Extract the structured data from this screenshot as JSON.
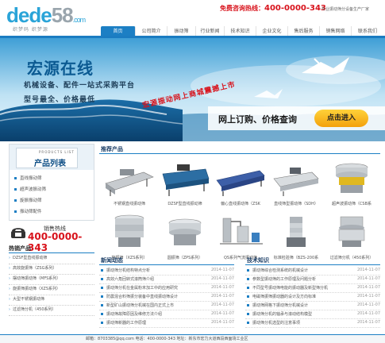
{
  "header": {
    "logo_main_a": "dede",
    "logo_main_b": "58",
    "logo_com": ".com",
    "logo_tag": "织梦码 织梦源",
    "hotline_label": "免费咨询热线：",
    "hotline_number": "400-0000-343",
    "slogan": "专业振动筛分设备生产厂家"
  },
  "nav": {
    "items": [
      {
        "label": "首页",
        "active": true
      },
      {
        "label": "公司简介",
        "active": false
      },
      {
        "label": "振动筛",
        "active": false
      },
      {
        "label": "行业新闻",
        "active": false
      },
      {
        "label": "技术知识",
        "active": false
      },
      {
        "label": "企业文化",
        "active": false
      },
      {
        "label": "售后服务",
        "active": false
      },
      {
        "label": "销售网络",
        "active": false
      },
      {
        "label": "联系我们",
        "active": false
      }
    ]
  },
  "banner": {
    "title": "宏源在线",
    "line1": "机械设备、配件一站式采购平台",
    "line2": "型号最全、价格最低",
    "diagonal": "宏源振动网上商城震撼上市",
    "buy_text": "网上订购、价格查询",
    "enter_button": "点击进入"
  },
  "sidebar": {
    "cat_en": "PRODUCTS LIST",
    "cat_cn": "产品列表",
    "categories": [
      "直线振动筛",
      "超声波振动筛",
      "旋振振动筛",
      "振动筛配件"
    ],
    "contact_label": "销售热线",
    "contact_number": "400-0000-343",
    "hot_title": "热销产品",
    "hot_items": [
      "DZSF型直线振动筛",
      "高效旋振筛（ZSG系列）",
      "摆动筛振动筛（MFS系列）",
      "旋振筛振动筛（XZS系列）",
      "大型不锈钢振动筛",
      "过滤筛分机（450系列）"
    ]
  },
  "recommend": {
    "title": "推荐产品",
    "products": [
      "不锈钢直线振动筛",
      "DZSF型直线振动筛",
      "偏心直线振动筛（ZSK",
      "直线筛型振动筛（SDH）",
      "超声波振动筛（CSB系",
      "旋振筛（XZS系列）",
      "圆振筛（ZPS系列）",
      "QS系列气流振动筛",
      "标准检验筛（BZS-200系",
      "过滤筛分机（450系列）"
    ]
  },
  "news_left": {
    "title": "新闻动态",
    "rows": [
      {
        "text": "振动筛分机结构特点分析",
        "date": "2014-11-07"
      },
      {
        "text": "高效六角回转式滚筒筛介绍",
        "date": "2014-11-07"
      },
      {
        "text": "振动筛分机在金属粉末加工中的应用研究",
        "date": "2014-11-07"
      },
      {
        "text": "防震混合料筛振分装备中直线振动筛设计",
        "date": "2014-11-07"
      },
      {
        "text": "新型矿山振动筛分机械在国内正式上市",
        "date": "2014-11-07"
      },
      {
        "text": "振动筛故障原因及维修方法介绍",
        "date": "2014-11-07"
      },
      {
        "text": "振动筛新器的工作原理",
        "date": "2014-11-07"
      }
    ]
  },
  "news_right": {
    "title": "技术知识",
    "rows": [
      {
        "text": "振动筛综合检测系统的机械设计",
        "date": "2014-11-07"
      },
      {
        "text": "参数型振动筛的工作原理及问题分析",
        "date": "2014-11-07"
      },
      {
        "text": "不同型号振动筛电能的振动器及新型筛分机",
        "date": "2014-11-07"
      },
      {
        "text": "电磁筛振筛振动器的设计及方向标准",
        "date": "2014-11-07"
      },
      {
        "text": "振动筛网格下振动筛分机械设计",
        "date": "2014-11-07"
      },
      {
        "text": "振动筛分机的轴承与滚动结构模型",
        "date": "2014-11-07"
      },
      {
        "text": "振动筛分机选型的注意事项",
        "date": "2014-11-07"
      }
    ]
  },
  "footer": {
    "text": "邮箱：8703385@qq.com 电话：400-0000-343 地址：新东市宏力大道西段西面场工业区"
  },
  "colors": {
    "brand_blue": "#1c7fc4",
    "hotline_red": "#d8121b",
    "button_yellow": "#f3a10c"
  }
}
